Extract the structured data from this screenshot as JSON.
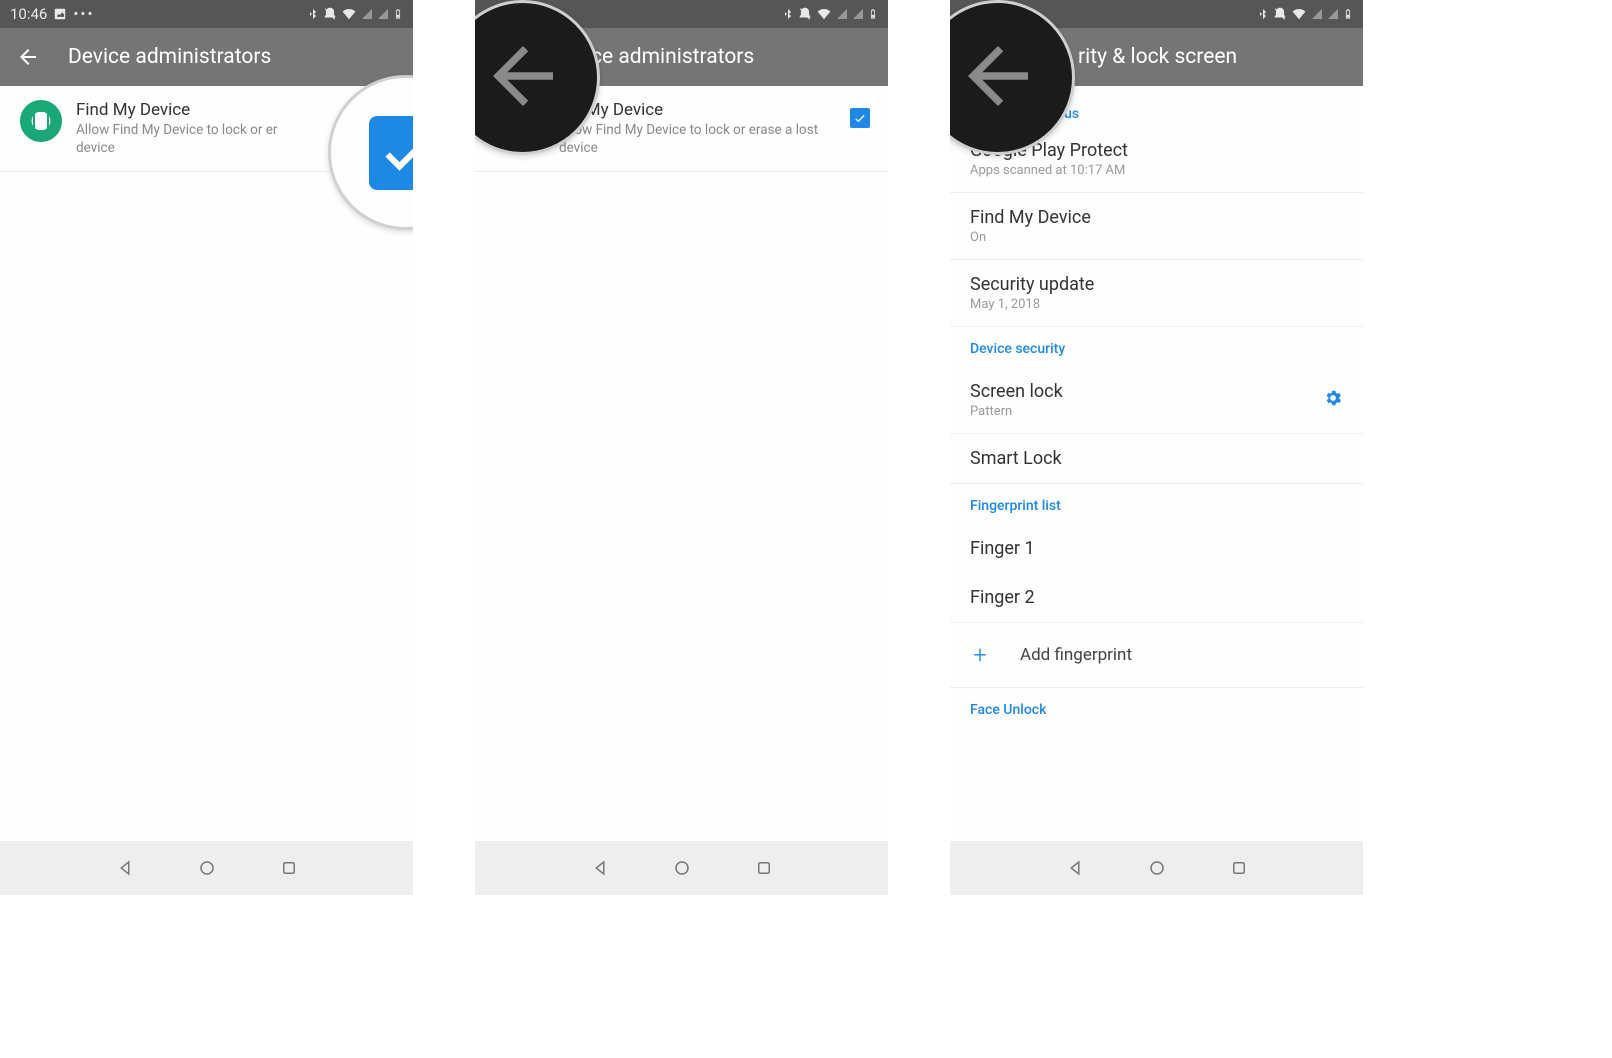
{
  "statusbar": {
    "time": "10:46",
    "icons_label": "status-icons"
  },
  "screen1": {
    "appbar_title": "Device administrators",
    "item_title": "Find My Device",
    "item_sub_truncated": "Allow Find My Device to lock or er",
    "item_sub_line2": "device"
  },
  "screen2": {
    "appbar_title_fragment": "ce administrators",
    "item_title_fragment": "nd My Device",
    "item_sub": "Allow Find My Device to lock or erase a lost",
    "item_sub_line2": "device"
  },
  "screen3": {
    "appbar_title_fragment": "rity & lock screen",
    "header0_fragment": "status",
    "r1_title": "Google Play Protect",
    "r1_sub": "Apps scanned at 10:17 AM",
    "r2_title": "Find My Device",
    "r2_sub": "On",
    "r3_title": "Security update",
    "r3_sub": "May 1, 2018",
    "header1": "Device security",
    "r4_title": "Screen lock",
    "r4_sub": "Pattern",
    "r5_title": "Smart Lock",
    "header2": "Fingerprint list",
    "r6_title": "Finger 1",
    "r7_title": "Finger 2",
    "add_label": "Add fingerprint",
    "header3": "Face Unlock"
  },
  "callouts": {
    "c1": "enable-checkbox-highlight",
    "c2": "back-arrow-highlight",
    "c3": "back-arrow-highlight"
  }
}
